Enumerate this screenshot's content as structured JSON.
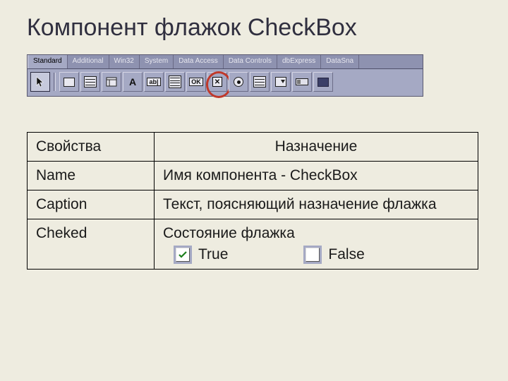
{
  "title": "Компонент флажок CheckBox",
  "palette": {
    "tabs": [
      "Standard",
      "Additional",
      "Win32",
      "System",
      "Data Access",
      "Data Controls",
      "dbExpress",
      "DataSna"
    ],
    "active_tab_index": 0,
    "tools": [
      {
        "name": "pointer-icon",
        "glyph": "arrow"
      },
      {
        "name": "mainmenu-icon",
        "glyph": "menu"
      },
      {
        "name": "popupmenu-icon",
        "glyph": "popup"
      },
      {
        "name": "label-icon",
        "glyph": "A"
      },
      {
        "name": "edit-icon",
        "glyph": "ab"
      },
      {
        "name": "memo-icon",
        "glyph": "memo"
      },
      {
        "name": "button-icon",
        "glyph": "OK"
      },
      {
        "name": "checkbox-icon",
        "glyph": "x",
        "highlighted": true
      },
      {
        "name": "radiobutton-icon",
        "glyph": "radio"
      },
      {
        "name": "listbox-icon",
        "glyph": "list"
      },
      {
        "name": "combobox-icon",
        "glyph": "drop"
      },
      {
        "name": "scrollbar-icon",
        "glyph": "scroll"
      },
      {
        "name": "groupbox-icon",
        "glyph": "group"
      }
    ]
  },
  "table": {
    "headers": {
      "property": "Свойства",
      "description": "Назначение"
    },
    "rows": [
      {
        "property": "Name",
        "description": "Имя компонента - CheckBox"
      },
      {
        "property": "Caption",
        "description": "Текст, поясняющий назначение флажка"
      },
      {
        "property": "Cheked",
        "description": "Состояние флажка",
        "examples": [
          {
            "label": "True",
            "checked": true
          },
          {
            "label": "False",
            "checked": false
          }
        ]
      }
    ]
  }
}
